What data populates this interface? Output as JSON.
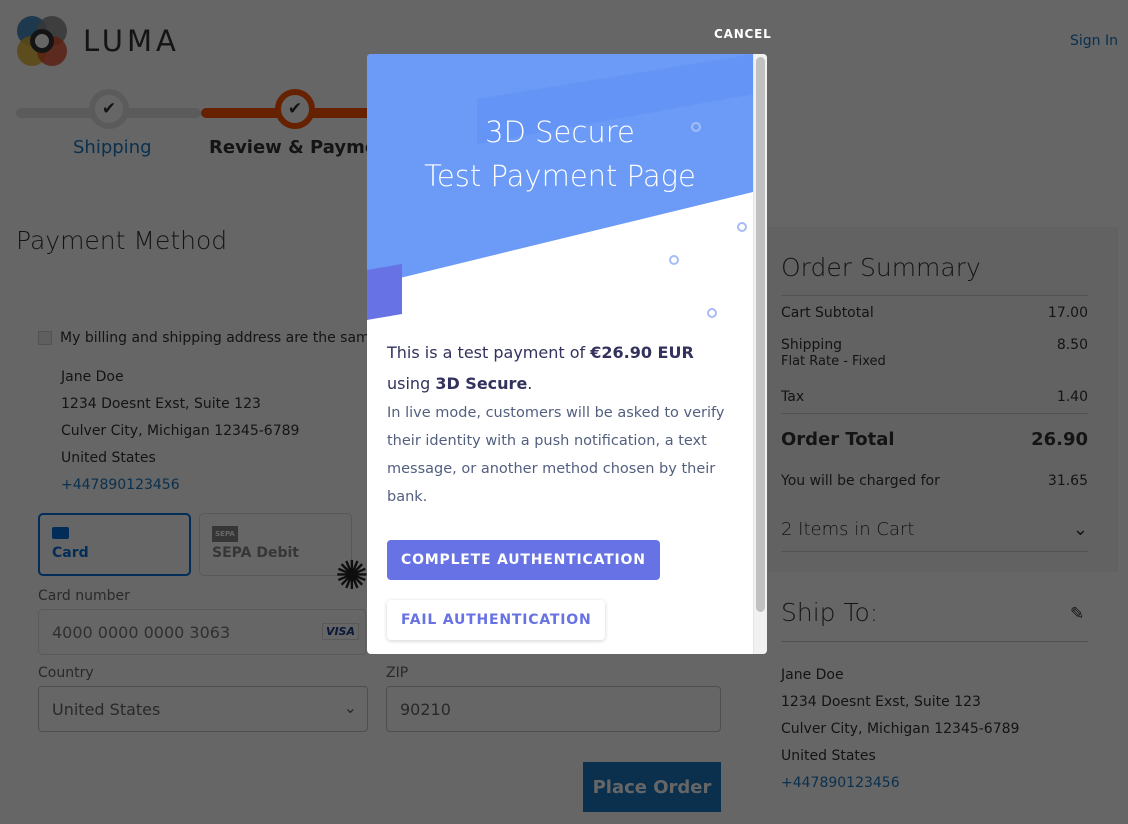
{
  "header": {
    "brand": "LUMA",
    "sign_in": "Sign In"
  },
  "progress": {
    "steps": [
      {
        "label": "Shipping",
        "complete": true
      },
      {
        "label": "Review & Payments",
        "complete": true,
        "active": true
      }
    ]
  },
  "payment": {
    "title": "Payment Method",
    "same_address_label": "My billing and shipping address are the same",
    "address": [
      "Jane Doe",
      "1234 Doesnt Exst, Suite 123",
      "Culver City, Michigan 12345-6789",
      "United States"
    ],
    "phone": "+447890123456",
    "tabs": [
      {
        "label": "Card",
        "icon": "card-icon",
        "selected": true
      },
      {
        "label": "SEPA Debit",
        "icon": "sepa-icon",
        "badge": "SEPA"
      }
    ],
    "card_number_label": "Card number",
    "card_number": "4000 0000 0000 3063",
    "card_brand": "VISA",
    "country_label": "Country",
    "country": "United States",
    "zip_label": "ZIP",
    "zip": "90210",
    "place_order": "Place Order"
  },
  "summary": {
    "title": "Order Summary",
    "rows": [
      {
        "label": "Cart Subtotal",
        "value": "17.00"
      },
      {
        "label": "Shipping",
        "sub": "Flat Rate - Fixed",
        "value": "8.50"
      },
      {
        "label": "Tax",
        "value": "1.40"
      }
    ],
    "total_label": "Order Total",
    "total": "26.90",
    "charged_label": "You will be charged for",
    "charged": "31.65",
    "items": "2 Items in Cart"
  },
  "ship_to": {
    "title": "Ship To:",
    "address": [
      "Jane Doe",
      "1234 Doesnt Exst, Suite 123",
      "Culver City, Michigan 12345-6789",
      "United States"
    ],
    "phone": "+447890123456"
  },
  "modal": {
    "cancel": "CANCEL",
    "title_line1": "3D Secure",
    "title_line2": "Test Payment Page",
    "intro_prefix": "This is a test payment of ",
    "amount": "€26.90 EUR",
    "intro_mid": "using ",
    "method": "3D Secure",
    "intro_end": ".",
    "description": "In live mode, customers will be asked to verify their identity with a push notification, a text message, or another method chosen by their bank.",
    "complete": "COMPLETE AUTHENTICATION",
    "fail": "FAIL AUTHENTICATION",
    "accent": "#6772e5",
    "header_blue": "#6b9bf6"
  }
}
